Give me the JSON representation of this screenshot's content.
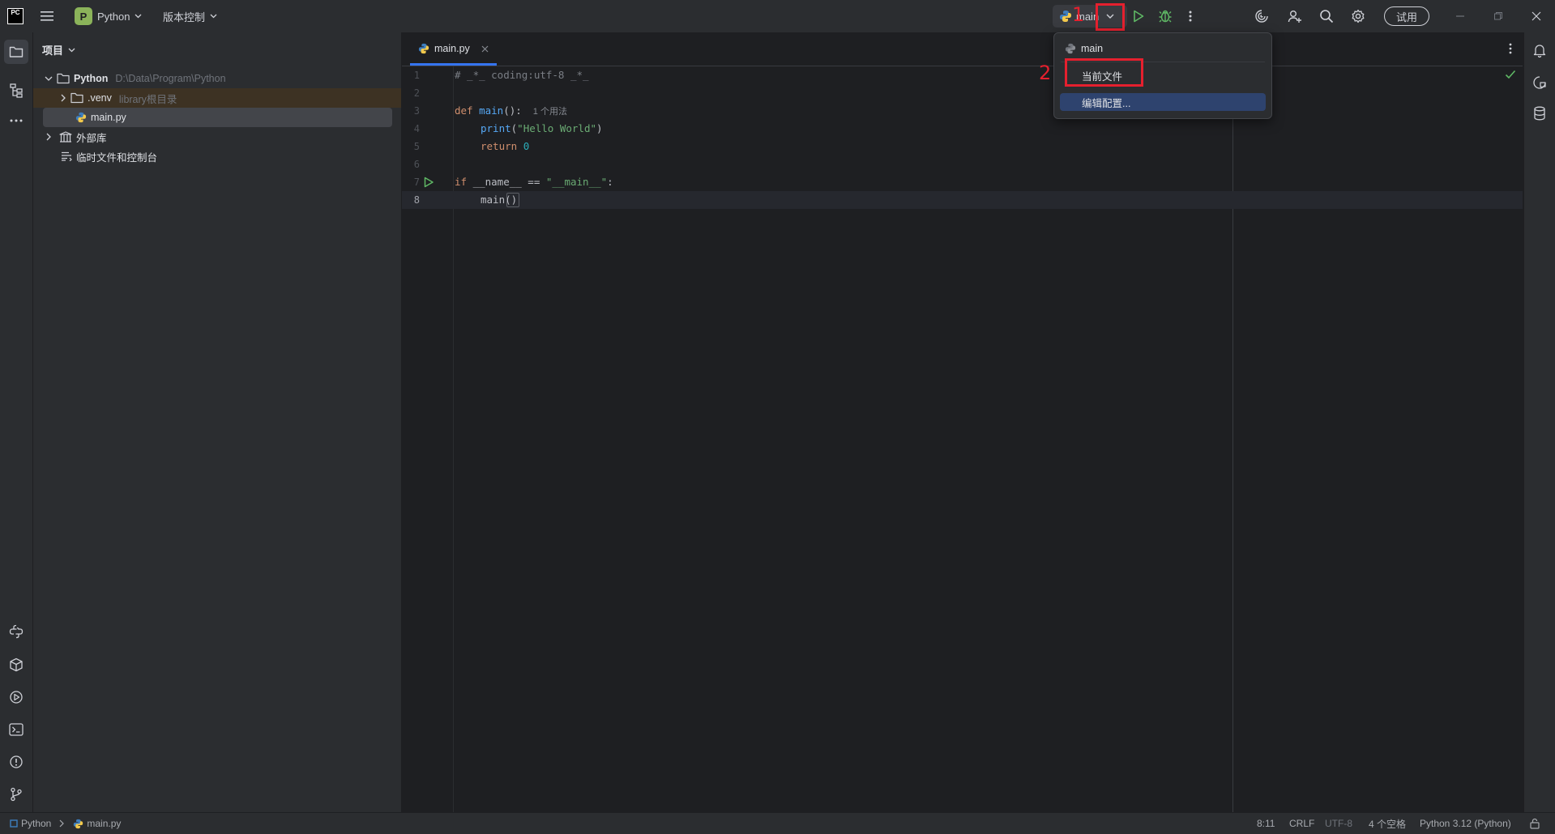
{
  "titlebar": {
    "app_logo": "PC",
    "project_badge": "P",
    "project_name": "Python",
    "vcs_label": "版本控制",
    "run_config": "main",
    "trial_label": "试用"
  },
  "project_panel": {
    "title": "项目",
    "tree": {
      "root_name": "Python",
      "root_path": "D:\\Data\\Program\\Python",
      "venv_name": ".venv",
      "venv_note": "library根目录",
      "file_name": "main.py",
      "external_libs": "外部库",
      "scratches": "临时文件和控制台"
    }
  },
  "editor": {
    "tab_label": "main.py",
    "line_numbers": [
      "1",
      "2",
      "3",
      "4",
      "5",
      "6",
      "7",
      "8"
    ],
    "code": {
      "l1": "# _*_ coding:utf-8 _*_",
      "l3_kw": "def ",
      "l3_fn": "main",
      "l3_rest": "():",
      "l3_hint": "1 个用法",
      "l4_fn": "print",
      "l4_open": "(",
      "l4_str": "\"Hello World\"",
      "l4_close": ")",
      "l5_kw": "return ",
      "l5_num": "0",
      "l7_kw": "if ",
      "l7_mid": "__name__ == ",
      "l7_str": "\"__main__\"",
      "l7_end": ":",
      "l8": "main()"
    }
  },
  "popup": {
    "items": [
      "main",
      "当前文件",
      "编辑配置..."
    ],
    "annotation_1": "1",
    "annotation_2": "2"
  },
  "statusbar": {
    "breadcrumb_project": "Python",
    "breadcrumb_file": "main.py",
    "position": "8:11",
    "line_ending": "CRLF",
    "encoding": "UTF-8",
    "indent": "4 个空格",
    "interpreter": "Python 3.12 (Python)"
  },
  "colors": {
    "accent": "#3574f0",
    "annotation_red": "#e5202e",
    "run_green": "#5fb865",
    "project_badge": "#8bb35a"
  }
}
